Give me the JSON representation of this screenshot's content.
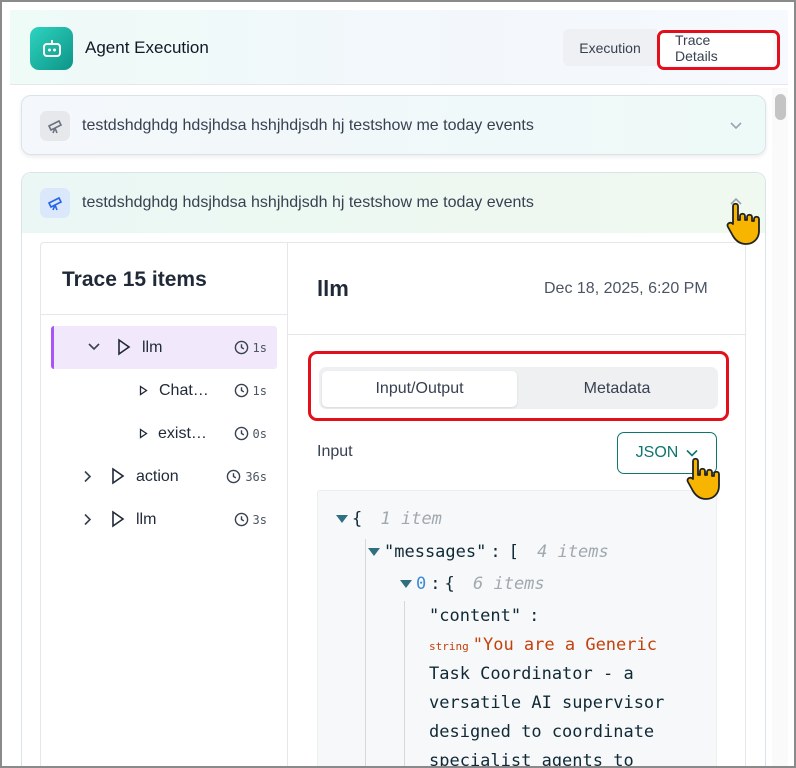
{
  "header": {
    "app_title": "Agent Execution",
    "tabs": [
      {
        "label": "Execution",
        "active": false
      },
      {
        "label": "Trace Details",
        "active": true
      }
    ]
  },
  "accordions": [
    {
      "title": "testdshdghdg hdsjhdsa hshjhdjsdh hj testshow me today events",
      "expanded": false,
      "icon": "telescope-icon"
    },
    {
      "title": "testdshdghdg hdsjhdsa hshjhdjsdh hj testshow me today events",
      "expanded": true,
      "icon": "telescope-icon"
    }
  ],
  "trace": {
    "title": "Trace 15 items",
    "items": [
      {
        "label": "llm",
        "duration": "1s",
        "selected": true,
        "expanded": true
      },
      {
        "label": "Chat…",
        "duration": "1s",
        "selected": false
      },
      {
        "label": "exist…",
        "duration": "0s",
        "selected": false
      },
      {
        "label": "action",
        "duration": "36s",
        "selected": false,
        "expanded": false
      },
      {
        "label": "llm",
        "duration": "3s",
        "selected": false,
        "expanded": false
      }
    ]
  },
  "detail": {
    "title": "llm",
    "date": "Dec 18, 2025, 6:20 PM",
    "segments": [
      "Input/Output",
      "Metadata"
    ],
    "active_segment": "Input/Output",
    "input_label": "Input",
    "format_button": "JSON"
  },
  "json_view": {
    "root_brace": "{",
    "root_count": "1 item",
    "messages_key": "\"messages\"",
    "colon": ":",
    "messages_bracket": "[",
    "messages_count": "4 items",
    "index0": "0",
    "index0_brace": "{",
    "index0_count": "6 items",
    "content_key": "\"content\"",
    "string_tag": "string",
    "content_lines": [
      "\"You are a Generic",
      "Task Coordinator - a",
      "versatile AI supervisor",
      "designed to coordinate",
      "specialist agents to"
    ]
  },
  "colors": {
    "accent_teal": "#0f766e",
    "highlight_red": "#e3101c",
    "selected_purple": "#a855f7",
    "string_orange": "#c2410c"
  }
}
